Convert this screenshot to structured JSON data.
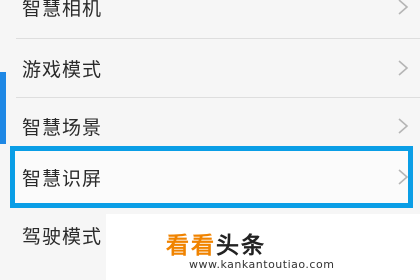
{
  "menu": {
    "items": [
      {
        "label": "智慧相机"
      },
      {
        "label": "游戏模式"
      },
      {
        "label": "智慧场景"
      },
      {
        "label": "智慧识屏"
      },
      {
        "label": "驾驶模式"
      }
    ],
    "highlighted_index": 3
  },
  "colors": {
    "highlight_border": "#0a9ee6",
    "accent_bar": "#1e88e5"
  },
  "watermark": {
    "brand_part1": "看看",
    "brand_part2": "头条",
    "url": "www.kankantoutiao.com"
  },
  "icons": {
    "row_chevron": "chevron-right-icon"
  }
}
